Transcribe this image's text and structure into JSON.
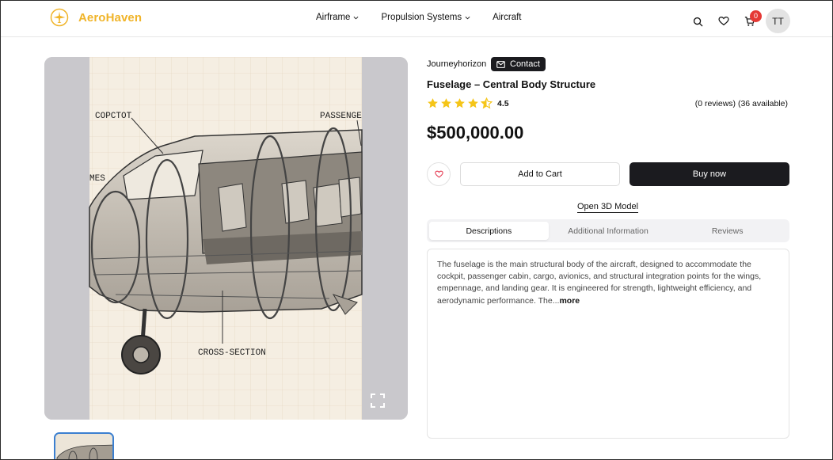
{
  "header": {
    "logo_text": "AeroHaven",
    "nav": [
      {
        "label": "Airframe",
        "has_dropdown": true
      },
      {
        "label": "Propulsion Systems",
        "has_dropdown": true
      },
      {
        "label": "Aircraft",
        "has_dropdown": false
      }
    ],
    "cart_count": "0",
    "avatar_initials": "TT"
  },
  "gallery": {
    "image_labels": {
      "cockpit": "COPCTOT",
      "passenger": "PASSENGE",
      "frames": "MES",
      "cross_section": "CROSS-SECTION"
    }
  },
  "product": {
    "seller": "Journeyhorizon",
    "contact_label": "Contact",
    "title": "Fuselage – Central Body Structure",
    "rating": "4.5",
    "reviews_info": "(0 reviews) (36 available)",
    "price": "$500,000.00",
    "add_to_cart_label": "Add to Cart",
    "buy_now_label": "Buy now",
    "open_3d_label": "Open 3D Model",
    "tabs": [
      "Descriptions",
      "Additional Information",
      "Reviews"
    ],
    "description": "The fuselage is the main structural body of the aircraft, designed to accommodate the cockpit, passenger cabin, cargo, avionics, and structural integration points for the wings, empennage, and landing gear. It is engineered for strength, lightweight efficiency, and aerodynamic performance. The...",
    "more_label": "more"
  },
  "colors": {
    "brand": "#f0b429",
    "star": "#f5c518",
    "dark_button": "#1b1b1f",
    "badge": "#e53935",
    "heart": "#e53950"
  },
  "icons": [
    "airplane-logo-icon",
    "chevron-down-icon",
    "search-icon",
    "heart-icon",
    "cart-icon",
    "mail-icon",
    "star-icon",
    "fullscreen-icon"
  ]
}
